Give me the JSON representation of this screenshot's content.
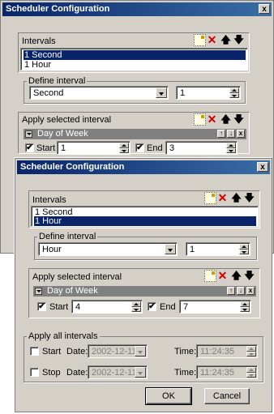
{
  "window1": {
    "title": "Scheduler Configuration",
    "close": "x",
    "intervals_label": "Intervals",
    "intervals": [
      "1 Second",
      "1 Hour"
    ],
    "selected_index": 0,
    "define_interval_label": "Define interval",
    "unit_value": "Second",
    "amount_value": "1",
    "apply_selected_label": "Apply selected interval",
    "rule_title": "Day of Week",
    "start_label": "Start",
    "start_value": "1",
    "end_label": "End",
    "end_value": "3"
  },
  "window2": {
    "title": "Scheduler Configuration",
    "close": "x",
    "intervals_label": "Intervals",
    "intervals": [
      "1 Second",
      "1 Hour"
    ],
    "selected_index": 1,
    "define_interval_label": "Define interval",
    "unit_value": "Hour",
    "amount_value": "1",
    "apply_selected_label": "Apply selected interval",
    "rule_title": "Day of Week",
    "start_label": "Start",
    "start_value": "4",
    "end_label": "End",
    "end_value": "7",
    "apply_all_label": "Apply all intervals",
    "start_row": {
      "label": "Start",
      "date_label": "Date:",
      "date_value": "2002-12-11",
      "time_label": "Time:",
      "time_value": "11:24:35"
    },
    "stop_row": {
      "label": "Stop",
      "date_label": "Date:",
      "date_value": "2002-12-11",
      "time_label": "Time:",
      "time_value": "11:24:35"
    },
    "ok_label": "OK",
    "cancel_label": "Cancel"
  },
  "icons": {
    "new": "new-item-icon",
    "delete": "delete-icon",
    "up": "arrow-up-icon",
    "down": "arrow-down-icon",
    "delete_glyph": "✕",
    "up_glyph": "🡅",
    "down_glyph": "🡇",
    "check_glyph": "✔",
    "mini_up": "↑",
    "mini_down": "↓",
    "mini_x": "x"
  },
  "colors": {
    "titlebar": "#0a246a",
    "selection": "#0a246a",
    "face": "#d4d0c8"
  }
}
